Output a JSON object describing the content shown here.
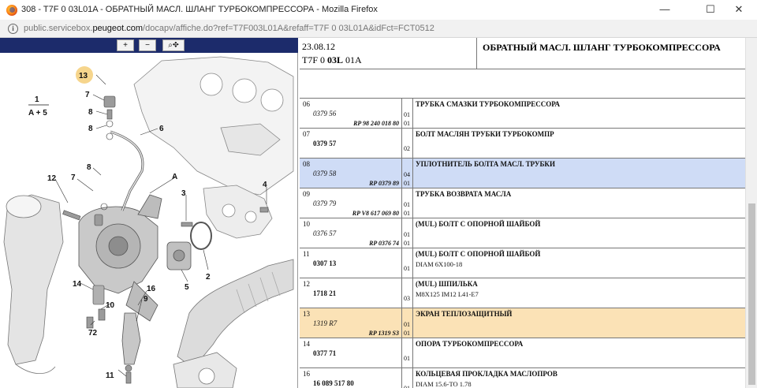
{
  "window": {
    "title": "308 - T7F 0 03L01A - ОБРАТНЫЙ МАСЛ. ШЛАНГ ТУРБОКОМПРЕССОРА - Mozilla Firefox",
    "min": "—",
    "max": "☐",
    "close": "✕"
  },
  "urlbar": {
    "prefix": "public.servicebox.",
    "domain": "peugeot.com",
    "path": "/docapv/affiche.do?ref=T7F003L01A&refaff=T7F 0 03L01A&idFct=FCT0512"
  },
  "toolbar": {
    "zoom_in": "+",
    "zoom_out": "−",
    "zoom_pan": "⌕✥"
  },
  "diagram": {
    "callouts": [
      "13",
      "7",
      "8",
      "8",
      "6",
      "1",
      "A + 5",
      "12",
      "7",
      "8",
      "A",
      "3",
      "4",
      "2",
      "5",
      "14",
      "10",
      "72",
      "16",
      "9",
      "11"
    ]
  },
  "header": {
    "date": "23.08.12",
    "ref_prefix": "T7F 0 ",
    "ref_bold": "03L",
    "ref_suffix": " 01A",
    "title": "ОБРАТНЫЙ МАСЛ. ШЛАНГ ТУРБОКОМПРЕССОРА"
  },
  "rows": [
    {
      "num": "06",
      "code": "0379 56",
      "ref": "RP 98 240 018 80",
      "q1": "01",
      "q2": "01",
      "desc": "ТРУБКА СМАЗКИ ТУРБОКОМПРЕССОРА",
      "sub": ""
    },
    {
      "num": "07",
      "code": "0379 57",
      "ref": "",
      "q1": "02",
      "q2": "",
      "desc": "БОЛТ МАСЛЯН ТРУБКИ ТУРБОКОМПР",
      "sub": ""
    },
    {
      "num": "08",
      "code": "0379 58",
      "ref": "RP 0379 89",
      "q1": "04",
      "q2": "01",
      "desc": "УПЛОТНИТЕЛЬ БОЛТА МАСЛ. ТРУБКИ",
      "sub": ""
    },
    {
      "num": "09",
      "code": "0379 79",
      "ref": "RP V8 617 069 80",
      "q1": "01",
      "q2": "01",
      "desc": "ТРУБКА ВОЗВРАТА МАСЛА",
      "sub": ""
    },
    {
      "num": "10",
      "code": "0376 57",
      "ref": "RP 0376 74",
      "q1": "01",
      "q2": "01",
      "desc": "(MUL) БОЛТ С ОПОРНОЙ ШАЙБОЙ",
      "sub": ""
    },
    {
      "num": "11",
      "code": "0307 13",
      "ref": "",
      "q1": "01",
      "q2": "",
      "desc": "(MUL) БОЛТ С ОПОРНОЙ ШАЙБОЙ",
      "sub": "DIAM 6X100-18"
    },
    {
      "num": "12",
      "code": "1718 21",
      "ref": "",
      "q1": "03",
      "q2": "",
      "desc": "(MUL) ШПИЛЬКА",
      "sub": "M8X125 IM12 L41-E7"
    },
    {
      "num": "13",
      "code": "1319 R7",
      "ref": "RP 1319 S3",
      "q1": "01",
      "q2": "01",
      "desc": "ЭКРАН ТЕПЛОЗАЩИТНЫЙ",
      "sub": ""
    },
    {
      "num": "14",
      "code": "0377 71",
      "ref": "",
      "q1": "01",
      "q2": "",
      "desc": "ОПОРА ТУРБОКОМПРЕССОРА",
      "sub": ""
    },
    {
      "num": "16",
      "code": "16 089 517 80",
      "ref": "",
      "q1": "01",
      "q2": "",
      "desc": "КОЛЬЦЕВАЯ ПРОКЛАДКА МАСЛОПРОВ",
      "sub": "DIAM 15.6-TO 1.78"
    }
  ],
  "colors": {
    "toolbar": "#1c2b6b",
    "selected_row": "#cfdcf6",
    "highlight_row": "#fbe2b6",
    "callout_circle": "#f6d58c"
  }
}
